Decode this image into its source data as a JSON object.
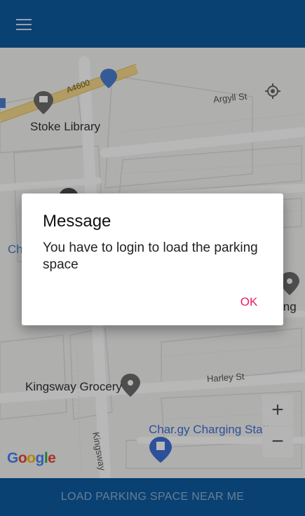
{
  "app": {
    "menu_icon": "hamburger-menu-icon",
    "bottom_button_label": "LOAD PARKING SPACE NEAR ME",
    "accent_color": "#0d5aa0"
  },
  "map": {
    "labels": {
      "road_a4600": "A4600",
      "argyll": "Argyll St",
      "stoke_library": "Stoke Library",
      "harley": "Harley St",
      "kingsway_grocery": "Kingsway Grocery",
      "kingsway_road": "Kingsway",
      "chargy": "Char.gy Charging Station",
      "left_partial": "Ch",
      "right_partial": "ing"
    },
    "zoom_in": "+",
    "zoom_out": "−",
    "google_logo": "Google"
  },
  "dialog": {
    "title": "Message",
    "message": "You have to login to load the parking space",
    "ok_label": "OK",
    "ok_color": "#e91e63"
  }
}
